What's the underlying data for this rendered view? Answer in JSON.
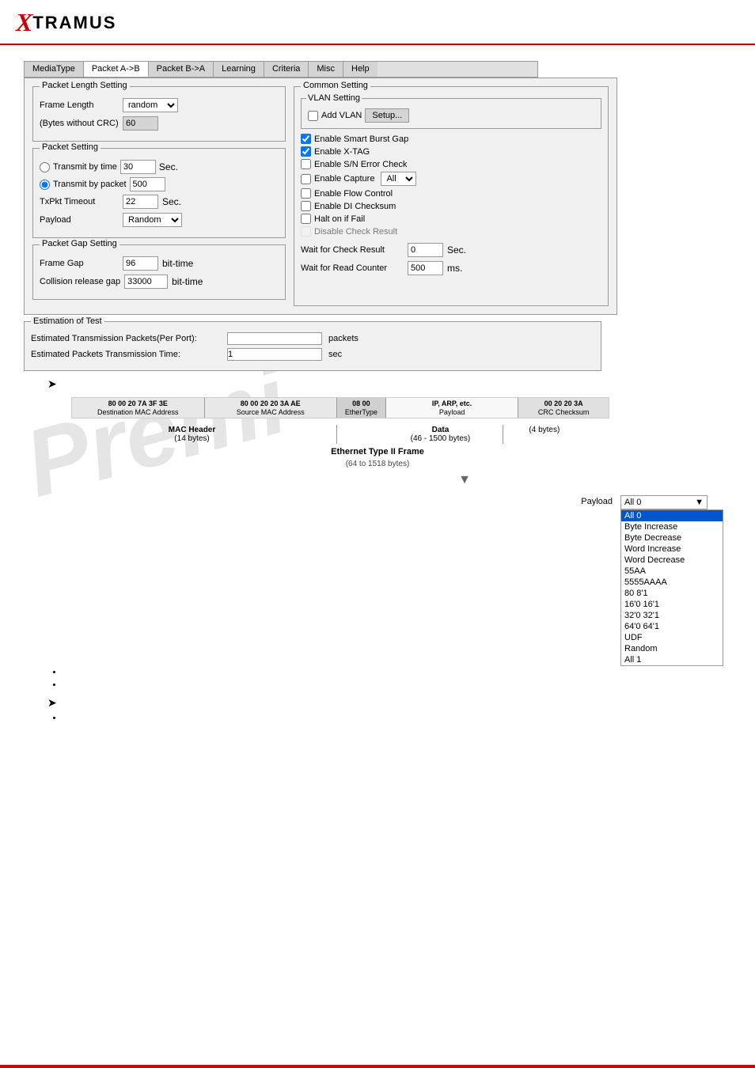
{
  "header": {
    "logo_x": "X",
    "logo_tramus": "TRAMUS"
  },
  "tabs": {
    "items": [
      {
        "label": "MediaType",
        "active": false
      },
      {
        "label": "Packet A->B",
        "active": true
      },
      {
        "label": "Packet B->A",
        "active": false
      },
      {
        "label": "Learning",
        "active": false
      },
      {
        "label": "Criteria",
        "active": false
      },
      {
        "label": "Misc",
        "active": false
      },
      {
        "label": "Help",
        "active": false
      }
    ]
  },
  "packet_length": {
    "title": "Packet Length Setting",
    "frame_length_label": "Frame Length",
    "frame_length_value": "random",
    "bytes_label": "(Bytes without CRC)",
    "bytes_value": "60"
  },
  "packet_setting": {
    "title": "Packet Setting",
    "transmit_time_label": "Transmit by time",
    "transmit_time_value": "30",
    "transmit_time_unit": "Sec.",
    "transmit_packet_label": "Transmit by packet",
    "transmit_packet_value": "500",
    "txpkt_label": "TxPkt Timeout",
    "txpkt_value": "22",
    "txpkt_unit": "Sec.",
    "payload_label": "Payload",
    "payload_value": "Random"
  },
  "packet_gap": {
    "title": "Packet Gap Setting",
    "frame_gap_label": "Frame Gap",
    "frame_gap_value": "96",
    "frame_gap_unit": "bit-time",
    "collision_label": "Collision release gap",
    "collision_value": "33000",
    "collision_unit": "bit-time"
  },
  "estimation": {
    "title": "Estimation of Test",
    "tx_packets_label": "Estimated Transmission Packets(Per Port):",
    "tx_packets_value": "",
    "tx_packets_unit": "packets",
    "tx_time_label": "Estimated Packets Transmission Time:",
    "tx_time_value": "1",
    "tx_time_unit": "sec"
  },
  "common_setting": {
    "title": "Common Setting",
    "vlan_title": "VLAN Setting",
    "add_vlan_label": "Add VLAN",
    "setup_btn": "Setup...",
    "checkboxes": [
      {
        "label": "Enable Smart Burst Gap",
        "checked": true
      },
      {
        "label": "Enable X-TAG",
        "checked": true
      },
      {
        "label": "Enable S/N Error Check",
        "checked": false
      },
      {
        "label": "Enable Capture",
        "checked": false
      },
      {
        "label": "Enable Flow Control",
        "checked": false
      },
      {
        "label": "Enable DI Checksum",
        "checked": false
      },
      {
        "label": "Halt on if Fail",
        "checked": false
      },
      {
        "label": "Disable Check Result",
        "checked": false,
        "disabled": true
      }
    ],
    "capture_dropdown": "All",
    "wait_check_label": "Wait for Check Result",
    "wait_check_value": "0",
    "wait_check_unit": "Sec.",
    "wait_read_label": "Wait for Read Counter",
    "wait_read_value": "500",
    "wait_read_unit": "ms."
  },
  "frame_diagram": {
    "cells": [
      {
        "hex": "80 00 20 7A 3F 3E",
        "label": "Destination MAC Address",
        "section": "mac"
      },
      {
        "hex": "80 00 20 20 3A AE",
        "label": "Source MAC Address",
        "section": "mac"
      },
      {
        "hex": "08 00",
        "label": "EtherType",
        "section": "ether"
      },
      {
        "hex": "IP, ARP, etc.",
        "label": "Payload",
        "section": "payload"
      },
      {
        "hex": "00 20 20 3A",
        "label": "CRC Checksum",
        "section": "crc"
      }
    ],
    "mac_header_label": "MAC Header",
    "mac_header_bytes": "(14 bytes)",
    "data_label": "Data",
    "data_bytes": "(46 - 1500 bytes)",
    "crc_bytes": "(4 bytes)",
    "frame_title": "Ethernet Type II Frame",
    "frame_subtitle": "(64 to 1518 bytes)"
  },
  "payload_section": {
    "label": "Payload",
    "selected": "All 0",
    "options": [
      {
        "label": "All 0",
        "selected": true
      },
      {
        "label": "Byte Increase",
        "selected": false
      },
      {
        "label": "Byte Decrease",
        "selected": false
      },
      {
        "label": "Word Increase",
        "selected": false
      },
      {
        "label": "Word Decrease",
        "selected": false
      },
      {
        "label": "55AA",
        "selected": false
      },
      {
        "label": "5555AAAA",
        "selected": false
      },
      {
        "label": "80 8'1",
        "selected": false
      },
      {
        "label": "16'0 16'1",
        "selected": false
      },
      {
        "label": "32'0 32'1",
        "selected": false
      },
      {
        "label": "64'0 64'1",
        "selected": false
      },
      {
        "label": "UDF",
        "selected": false
      },
      {
        "label": "Random",
        "selected": false
      },
      {
        "label": "All 1",
        "selected": false
      }
    ]
  },
  "watermark": "Premi",
  "arrows": {
    "right_arrow_1": "➤",
    "right_arrow_2": "➤",
    "down_arrow": "▼"
  }
}
